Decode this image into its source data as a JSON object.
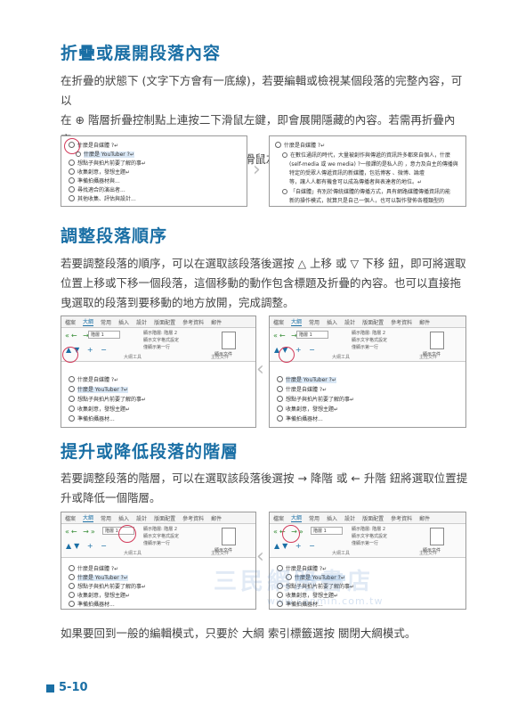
{
  "sections": [
    {
      "title": "折疊或展開段落內容",
      "para_lines": [
        "在折疊的狀態下 (文字下方會有一底線)，若要編輯或檢視某個段落的完整內容，可以",
        "在 ⊕ 階層折疊控制點上連按二下滑鼠左鍵，即會展開隱藏的內容。若需再折疊內容，",
        "只要在 ⊕ 階層折疊控制點上連按二下滑鼠左鍵。"
      ]
    },
    {
      "title": "調整段落順序",
      "para_lines": [
        "若要調整段落的順序，可以在選取該段落後選按 △ 上移 或 ▽ 下移 鈕，即可將選取",
        "位置上移或下移一個段落，這個移動的動作包含標題及折疊的內容。也可以直接拖",
        "曳選取的段落到要移動的地方放開，完成調整。"
      ]
    },
    {
      "title": "提升或降低段落的階層",
      "para_lines": [
        "若要調整段落的階層，可以在選取該段落後選按 → 降階 或 ← 升階 鈕將選取位置提",
        "升或降低一個階層。"
      ]
    }
  ],
  "closing_line": "如果要回到一般的編輯模式，只要於 大綱 索引標籤選按 關閉大綱模式。",
  "shot1": {
    "left_lines": [
      "什麼是自媒體 ?↵",
      "什麼是 YouTuber ?↵",
      "想點子與拍片前要了解的事↵",
      "收集創意，發想主題↵",
      "準備拍攝器材與...",
      "尋找適合的演出者...",
      "其他收集、評估與設計..."
    ],
    "right_lines": [
      "什麼是自媒體 ?↵",
      "在數位通訊的時代，大量被創作與傳遞的資訊許多都來自個人，什麼",
      "(self-media 或 we media) ?一般譯的是私人的 ，意力及自主的傳播與",
      "特定的受眾人傳遞資訊的新媒體，包括博客 、微博、論壇",
      "等，讓人人都有機會可以成為傳播者與表達者的地位。↵",
      "「自媒體」有別於傳統媒體的傳播方式，具有網路媒體傳播資訊的能",
      "新的操作模式，就算只是自己一個人，也可以製作發佈各種類型的"
    ]
  },
  "shot2": {
    "tabs": [
      "檔案",
      "大綱",
      "常用",
      "插入",
      "設計",
      "版面配置",
      "參考資料",
      "郵件",
      "校"
    ],
    "level": "階層 1",
    "opts": [
      "顯示階層: 階層 2",
      "顯示文字格式設定",
      "僅顯示第一行"
    ],
    "doc_label": "顯示文件",
    "group_label": "大綱工具",
    "group2_label": "主控文件",
    "left_lines": [
      "什麼是自媒體 ?↵",
      "什麼是 YouTuber ?↵",
      "想點子與拍片前要了解的事↵",
      "收集創意，發想主題↵",
      "準備拍攝器材..."
    ],
    "right_lines": [
      "什麼是 YouTuber ?↵",
      "什麼是自媒體 ?↵",
      "想點子與拍片前要了解的事↵",
      "收集創意，發想主題↵",
      "準備拍攝器材..."
    ]
  },
  "shot3": {
    "tabs": [
      "檔案",
      "大綱",
      "常用",
      "插入",
      "設計",
      "版面配置",
      "參考資料",
      "郵件",
      "校"
    ],
    "level": "階層 1",
    "opts": [
      "顯示階層: 階層 2",
      "顯示文字格式設定",
      "僅顯示第一行"
    ],
    "doc_label": "顯示文件",
    "group_label": "大綱工具",
    "group2_label": "主控文件",
    "left_lines": [
      "什麼是自媒體 ?↵",
      "什麼是 YouTuber ?↵",
      "想點子與拍片前要了解的事↵",
      "收集創意，發想主題↵",
      "準備拍攝器材..."
    ],
    "right_lines": [
      "什麼是自媒體 ?↵",
      "什麼是 YouTuber ?↵",
      "想點子與拍片前要了解的事↵",
      "收集創意，發想主題↵",
      "準備拍攝器材..."
    ]
  },
  "watermark": "三民網路書店",
  "watermark_url": "www.sanmin.com.tw",
  "page_number": "5-10"
}
